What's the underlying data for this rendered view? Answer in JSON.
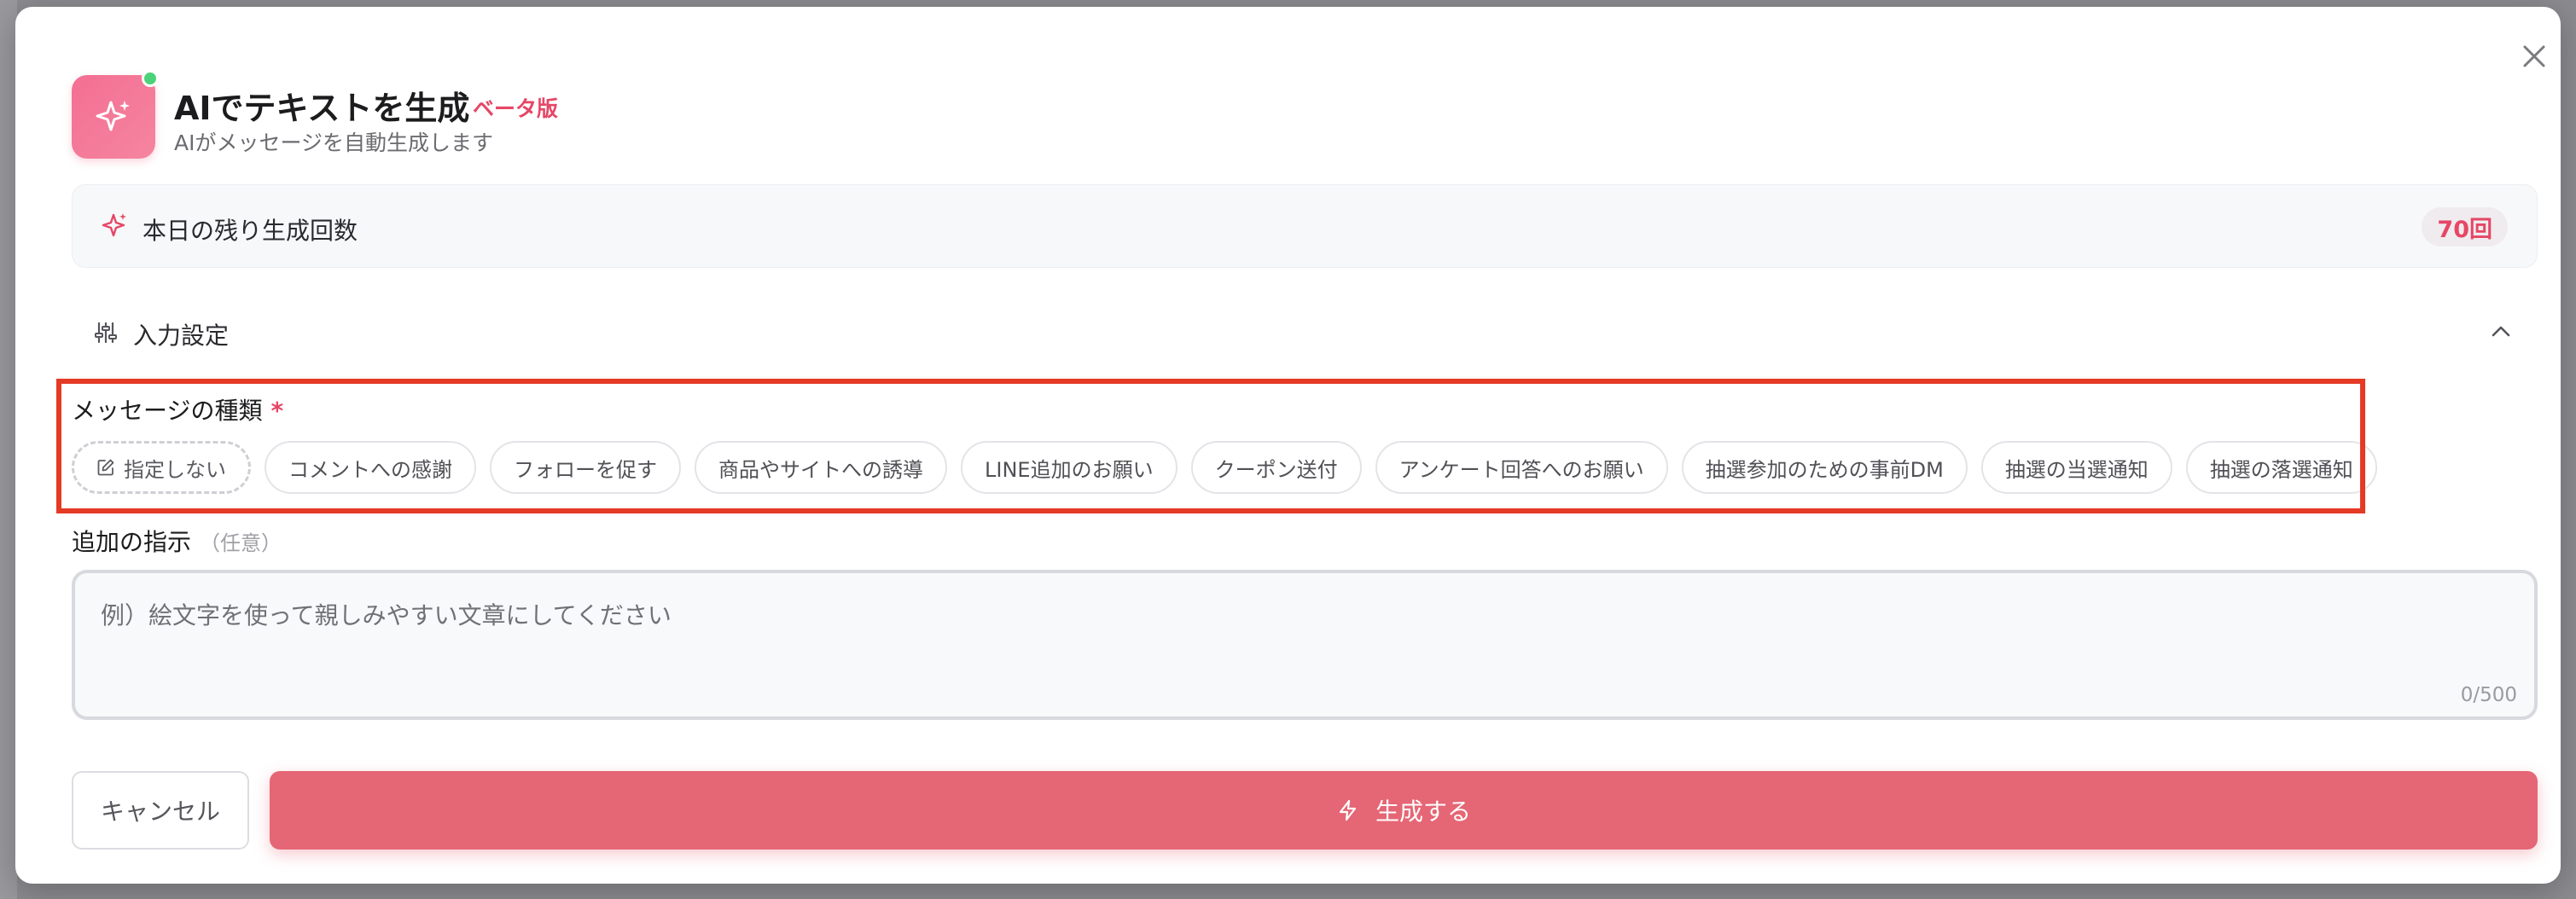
{
  "header": {
    "title": "AIでテキストを生成",
    "badge": "ベータ版",
    "subtitle": "AIがメッセージを自動生成します"
  },
  "quota": {
    "label": "本日の残り生成回数",
    "value": "70回"
  },
  "input_settings": {
    "label": "入力設定"
  },
  "message_type": {
    "label": "メッセージの種類",
    "required_mark": "*",
    "options": [
      "指定しない",
      "コメントへの感謝",
      "フォローを促す",
      "商品やサイトへの誘導",
      "LINE追加のお願い",
      "クーポン送付",
      "アンケート回答へのお願い",
      "抽選参加のための事前DM",
      "抽選の当選通知",
      "抽選の落選通知"
    ]
  },
  "extra_instruction": {
    "label": "追加の指示",
    "optional": "（任意）",
    "placeholder": "例）絵文字を使って親しみやすい文章にしてください",
    "counter": "0/500"
  },
  "actions": {
    "cancel": "キャンセル",
    "generate": "生成する"
  },
  "colors": {
    "accent": "#e54766",
    "primary_button": "#e56675",
    "highlight_border": "#e53a24"
  }
}
